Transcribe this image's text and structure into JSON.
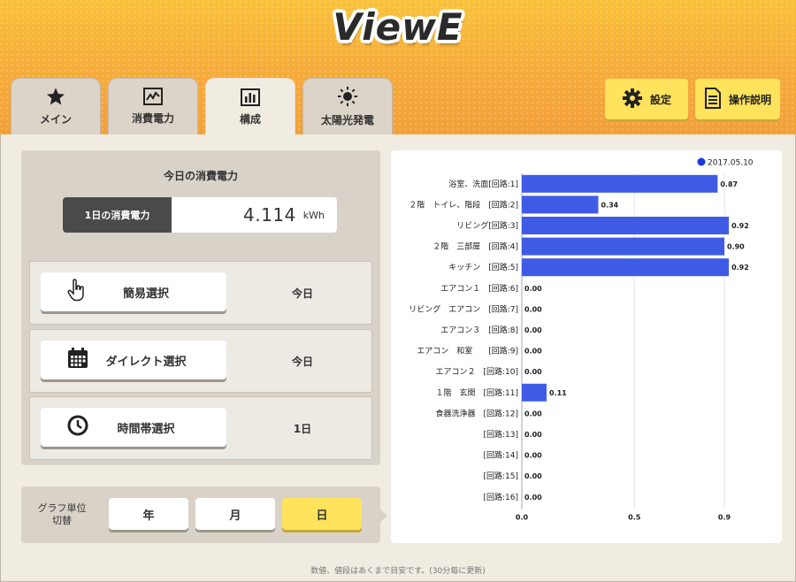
{
  "header": {
    "logo": "ViewE",
    "tabs": [
      {
        "label": "メイン",
        "icon": "star-icon"
      },
      {
        "label": "消費電力",
        "icon": "line-chart-icon"
      },
      {
        "label": "構成",
        "icon": "bar-chart-icon"
      },
      {
        "label": "太陽光発電",
        "icon": "sun-icon"
      }
    ],
    "active_tab": "構成",
    "settings_label": "設定",
    "manual_label": "操作説明"
  },
  "summary": {
    "title": "今日の消費電力",
    "key": "1日の消費電力",
    "value": "4.114",
    "unit": "kWh"
  },
  "modes": [
    {
      "label": "簡易選択",
      "icon": "hand-pointer-icon",
      "value": "今日"
    },
    {
      "label": "ダイレクト選択",
      "icon": "calendar-icon",
      "value": "今日"
    },
    {
      "label": "時間帯選択",
      "icon": "clock-icon",
      "value": "1日"
    }
  ],
  "unit_switch": {
    "label_line1": "グラフ単位",
    "label_line2": "切替",
    "options": [
      "年",
      "月",
      "日"
    ],
    "selected": "日"
  },
  "footer": "数値、値段はあくまで目安です。(30分毎に更新)",
  "colors": {
    "bar": "#3f5be6",
    "accent": "#ffe35c",
    "header": "#f6a93a"
  },
  "chart_data": {
    "type": "bar",
    "orientation": "horizontal",
    "legend": {
      "label": "2017.05.10",
      "position": "top-right"
    },
    "categories": [
      "浴室、洗面[回路:1]",
      "２階　トイレ、階段　[回路:2]",
      "リビング[回路:3]",
      "２階　三部屋　[回路:4]",
      "キッチン　[回路:5]",
      "エアコン１　[回路:6]",
      "リビング　エアコン　[回路:7]",
      "エアコン３　[回路:8]",
      "エアコン　和室　　[回路:9]",
      "エアコン２　[回路:10]",
      "１階　玄関　[回路:11]",
      "食器洗浄器　[回路:12]",
      "[回路:13]",
      "[回路:14]",
      "[回路:15]",
      "[回路:16]"
    ],
    "values": [
      0.87,
      0.34,
      0.92,
      0.9,
      0.92,
      0.0,
      0.0,
      0.0,
      0.0,
      0.0,
      0.11,
      0.0,
      0.0,
      0.0,
      0.0,
      0.0
    ],
    "value_labels": [
      "0.87",
      "0.34",
      "0.92",
      "0.90",
      "0.92",
      "0.00",
      "0.00",
      "0.00",
      "0.00",
      "0.00",
      "0.11",
      "0.00",
      "0.00",
      "0.00",
      "0.00",
      "0.00"
    ],
    "xlim": [
      0,
      0.9
    ],
    "xticks": [
      "0.0",
      "0.5",
      "0.9"
    ],
    "grid": true
  }
}
